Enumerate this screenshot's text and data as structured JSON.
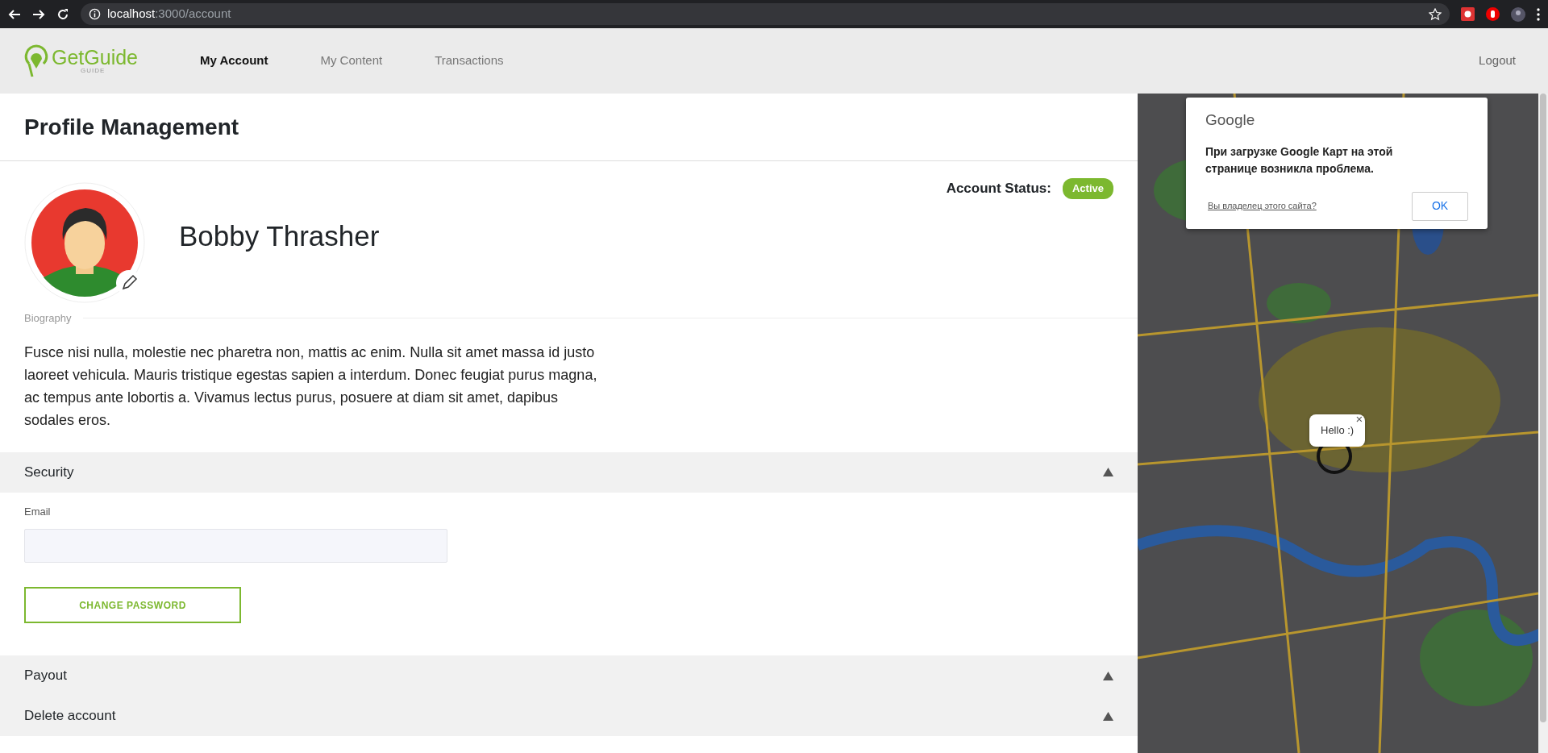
{
  "browser": {
    "url_host": "localhost",
    "url_path": ":3000/account"
  },
  "brand": {
    "name": "GetGuide",
    "tagline": "GUIDE"
  },
  "nav": [
    {
      "label": "My Account",
      "selected": true
    },
    {
      "label": "My Content",
      "selected": false
    },
    {
      "label": "Transactions",
      "selected": false
    }
  ],
  "logout": "Logout",
  "page_title": "Profile Management",
  "profile": {
    "name": "Bobby Thrasher",
    "status_label": "Account Status:",
    "status": "Active",
    "biography_label": "Biography",
    "biography": "Fusce nisi nulla, molestie nec pharetra non, mattis ac enim. Nulla sit amet massa id justo laoreet vehicula. Mauris tristique egestas sapien a interdum. Donec feugiat purus magna, ac tempus ante lobortis a. Vivamus lectus purus, posuere at diam sit amet, dapibus sodales eros."
  },
  "sections": [
    {
      "title": "Security",
      "expanded": true,
      "email_label": "Email",
      "button": "CHANGE PASSWORD"
    },
    {
      "title": "Payout",
      "expanded": false
    },
    {
      "title": "Delete account",
      "expanded": false
    }
  ],
  "map": {
    "dialog": {
      "brand": "Google",
      "message": "При загрузке Google Карт на этой странице возникла проблема.",
      "link": "Вы владелец этого сайта?",
      "button": "OK"
    },
    "popup": {
      "text": "Hello :)",
      "close": "×"
    }
  }
}
